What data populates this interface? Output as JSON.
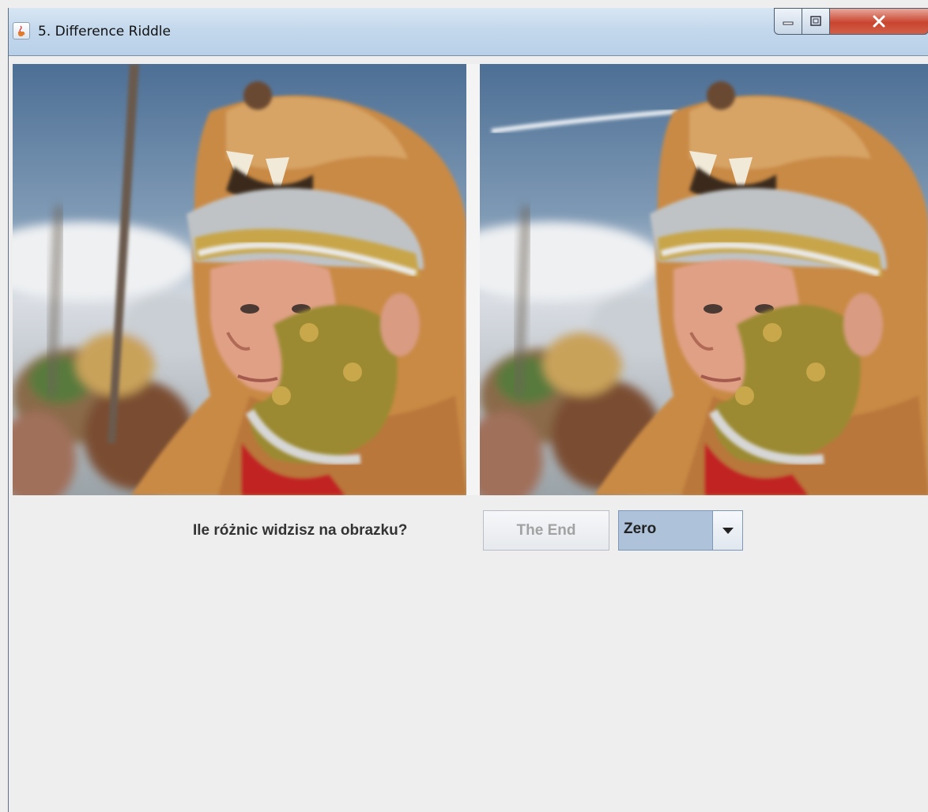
{
  "window": {
    "title": "5. Difference Riddle",
    "icon": "java-cup-icon",
    "controls": [
      "minimize-icon",
      "maximize-icon",
      "close-icon"
    ]
  },
  "images": {
    "left": "original-photo-roman-soldier",
    "right": "modified-photo-roman-soldier"
  },
  "form": {
    "question": "Ile różnic widzisz na obrazku?",
    "end_button": "The End",
    "count_select": {
      "selected": "Zero"
    }
  },
  "colors": {
    "background": "#eeeeee",
    "select_bg": "#aec3da",
    "disabled_text": "#a2a2a2"
  }
}
